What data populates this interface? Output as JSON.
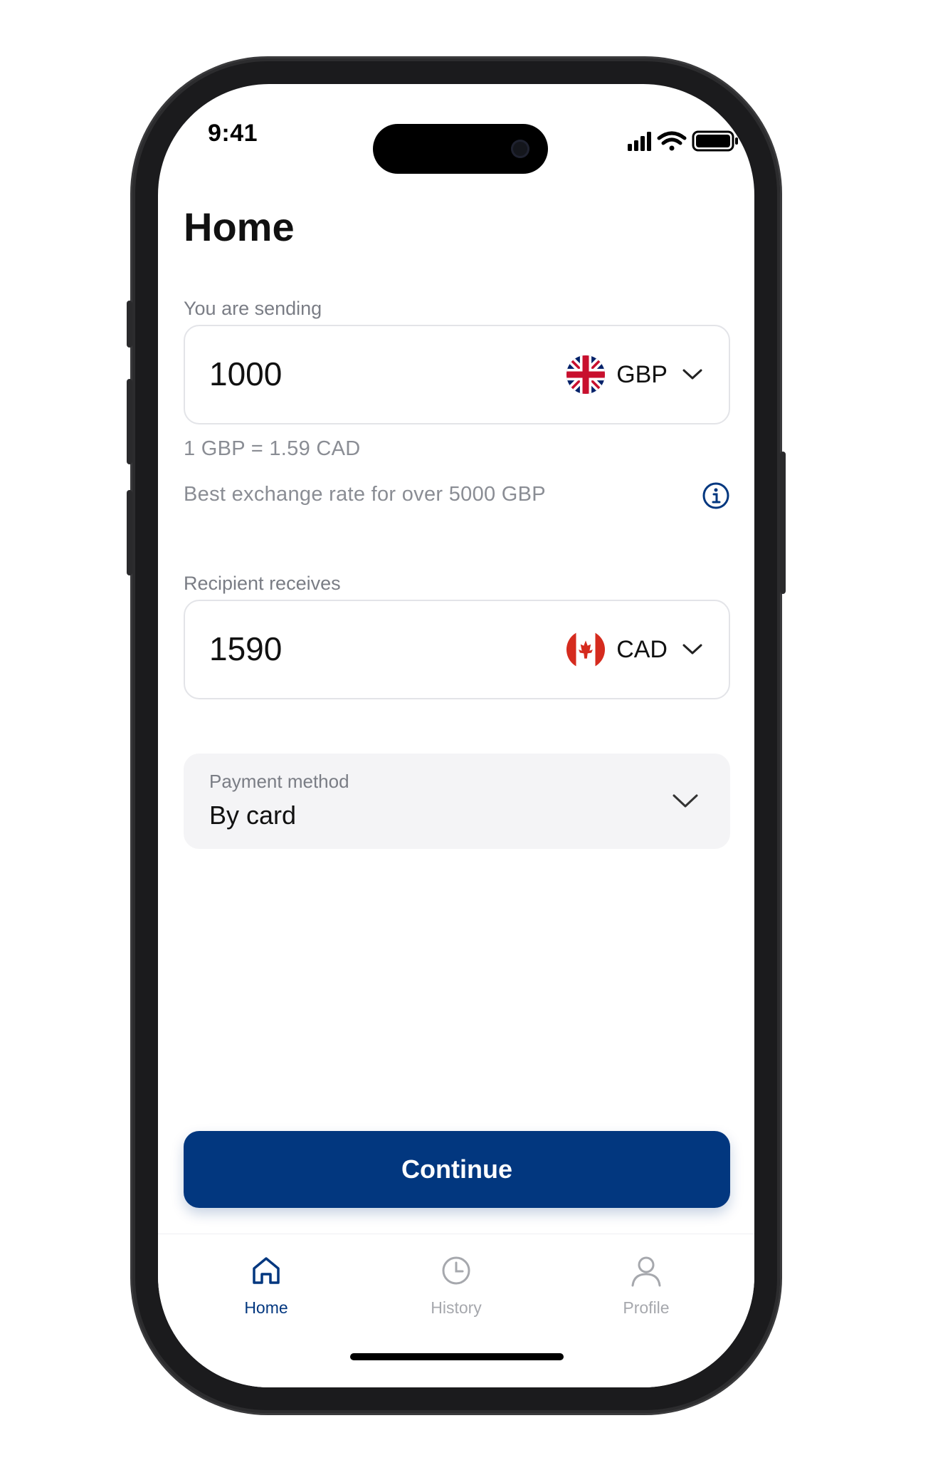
{
  "status_bar": {
    "time": "9:41"
  },
  "page": {
    "title": "Home"
  },
  "sending": {
    "label": "You are sending",
    "amount": "1000",
    "currency": "GBP",
    "flag": "uk-flag-icon"
  },
  "rate": {
    "text": "1 GBP = 1.59 CAD",
    "promo": "Best exchange rate for over 5000 GBP"
  },
  "receiving": {
    "label": "Recipient receives",
    "amount": "1590",
    "currency": "CAD",
    "flag": "canada-flag-icon"
  },
  "payment": {
    "label": "Payment method",
    "value": "By card"
  },
  "actions": {
    "continue_label": "Continue"
  },
  "tabs": [
    {
      "label": "Home",
      "icon": "home-icon",
      "active": true
    },
    {
      "label": "History",
      "icon": "clock-icon",
      "active": false
    },
    {
      "label": "Profile",
      "icon": "user-icon",
      "active": false
    }
  ],
  "colors": {
    "accent": "#02377f",
    "inactive": "#a6a8ad",
    "muted_text": "#8a8d94",
    "field_border": "#e3e4e8",
    "field_fill": "#f4f4f6"
  }
}
